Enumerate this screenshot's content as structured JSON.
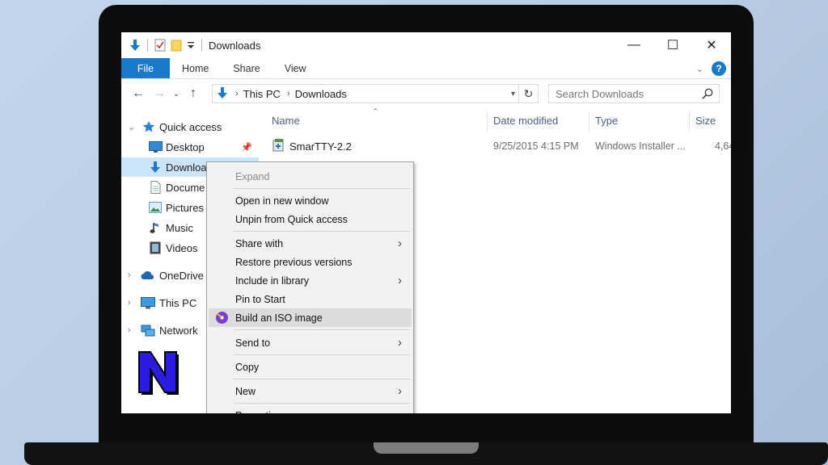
{
  "window": {
    "title": "Downloads",
    "minimize_glyph": "—",
    "maximize_glyph": "☐",
    "close_glyph": "✕"
  },
  "ribbon": {
    "tabs": [
      "File",
      "Home",
      "Share",
      "View"
    ],
    "expand_glyph": "⌄",
    "help_glyph": "?"
  },
  "address": {
    "back_glyph": "←",
    "forward_glyph": "→",
    "recent_glyph": "⌄",
    "up_glyph": "↑",
    "crumbs": [
      "This PC",
      "Downloads"
    ],
    "separator": "›",
    "search_placeholder": "Search Downloads"
  },
  "nav_pane": {
    "items": [
      {
        "label": "Quick access",
        "icon": "star-icon"
      },
      {
        "label": "Desktop",
        "icon": "desktop-icon"
      },
      {
        "label": "Downloa",
        "icon": "download-arrow-icon"
      },
      {
        "label": "Docume",
        "icon": "document-icon"
      },
      {
        "label": "Pictures",
        "icon": "pictures-icon"
      },
      {
        "label": "Music",
        "icon": "music-icon"
      },
      {
        "label": "Videos",
        "icon": "videos-icon"
      },
      {
        "label": "OneDrive",
        "icon": "cloud-icon"
      },
      {
        "label": "This PC",
        "icon": "computer-icon"
      },
      {
        "label": "Network",
        "icon": "network-icon"
      }
    ]
  },
  "file_list": {
    "columns": [
      "Name",
      "Date modified",
      "Type",
      "Size"
    ],
    "rows": [
      {
        "name": "SmarTTY-2.2",
        "date": "9/25/2015 4:15 PM",
        "type": "Windows Installer ...",
        "size": "4,64"
      }
    ]
  },
  "context_menu": {
    "items": [
      {
        "label": "Expand",
        "disabled": true
      },
      {
        "label": "Open in new window"
      },
      {
        "label": "Unpin from Quick access"
      },
      {
        "label": "Share with",
        "submenu": true
      },
      {
        "label": "Restore previous versions"
      },
      {
        "label": "Include in library",
        "submenu": true
      },
      {
        "label": "Pin to Start"
      },
      {
        "label": "Build an ISO image",
        "highlighted": true,
        "icon": "iso-builder-icon"
      },
      {
        "label": "Send to",
        "submenu": true
      },
      {
        "label": "Copy"
      },
      {
        "label": "New",
        "submenu": true
      },
      {
        "label": "Properties"
      }
    ],
    "submenu_glyph": "›"
  },
  "colors": {
    "accent": "#1979ca",
    "selection": "#cce4f7",
    "menu_bg": "#f2f2f2",
    "menu_hover": "#dcdcdc",
    "logo_fill": "#2b1de0"
  },
  "logo": {
    "letter": "N"
  }
}
